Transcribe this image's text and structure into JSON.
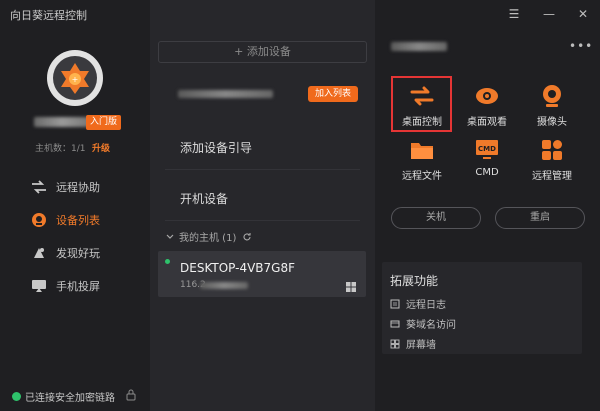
{
  "app": {
    "title": "向日葵远程控制"
  },
  "window": {
    "menu_icon": "menu-icon",
    "minimize_icon": "minimize-icon",
    "close_icon": "close-icon"
  },
  "colors": {
    "accent": "#f06a1c",
    "online": "#2ec26b",
    "highlight": "#e53535"
  },
  "profile": {
    "badge": "入门版",
    "host_count_label": "主机数：1/1",
    "upgrade_label": "升级"
  },
  "nav": {
    "items": [
      {
        "label": "远程协助",
        "icon": "remote-assist-icon"
      },
      {
        "label": "设备列表",
        "icon": "device-list-icon"
      },
      {
        "label": "发现好玩",
        "icon": "discover-icon"
      },
      {
        "label": "手机投屏",
        "icon": "screen-cast-icon"
      }
    ]
  },
  "status": {
    "secure": "已连接安全加密链路"
  },
  "devices": {
    "add_label": "+ 添加设备",
    "join_list": "加入列表",
    "guide_label": "添加设备引导",
    "wake_label": "开机设备",
    "my_hosts_label": "我的主机 (1)",
    "host": {
      "name": "DESKTOP-4VB7G8F",
      "ip_prefix": "116.2"
    }
  },
  "actions": {
    "features": [
      {
        "label": "桌面控制",
        "icon": "desktop-control-icon"
      },
      {
        "label": "桌面观看",
        "icon": "desktop-view-icon"
      },
      {
        "label": "摄像头",
        "icon": "camera-icon"
      },
      {
        "label": "远程文件",
        "icon": "folder-icon"
      },
      {
        "label": "CMD",
        "icon": "cmd-icon"
      },
      {
        "label": "远程管理",
        "icon": "remote-manage-icon"
      }
    ],
    "shutdown_label": "关机",
    "restart_label": "重启"
  },
  "extensions": {
    "title": "拓展功能",
    "items": [
      {
        "label": "远程日志",
        "icon": "log-icon"
      },
      {
        "label": "葵域名访问",
        "icon": "domain-icon"
      },
      {
        "label": "屏幕墙",
        "icon": "screen-wall-icon"
      }
    ]
  }
}
